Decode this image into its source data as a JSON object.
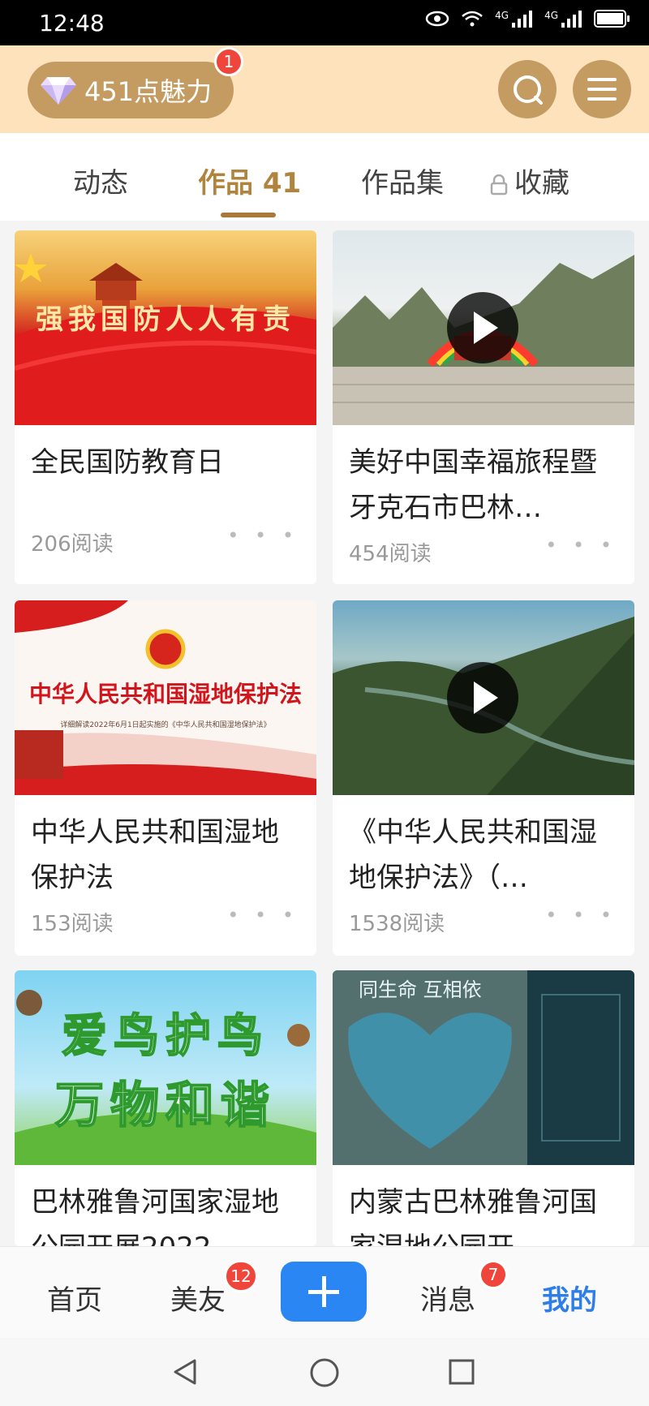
{
  "status": {
    "time": "12:48",
    "net1": "4G",
    "net2": "4G"
  },
  "header": {
    "points_label": "451点魅力",
    "points_badge": "1"
  },
  "tabs": [
    {
      "label": "动态"
    },
    {
      "label": "作品 41",
      "active": true
    },
    {
      "label": "作品集"
    },
    {
      "label": "收藏",
      "locked": true
    }
  ],
  "cards": [
    {
      "title": "全民国防教育日",
      "reads": "206阅读",
      "image_text": "强我国防人人有责",
      "video": false
    },
    {
      "title": "美好中国幸福旅程暨牙克石市巴林…",
      "reads": "454阅读",
      "video": true
    },
    {
      "title": "中华人民共和国湿地保护法",
      "reads": "153阅读",
      "image_text": "中华人民共和国湿地保护法",
      "image_subtext": "详细解读2022年6月1日起实施的《中华人民共和国湿地保护法》",
      "video": false
    },
    {
      "title": "《中华人民共和国湿地保护法》（…",
      "reads": "1538阅读",
      "video": true
    },
    {
      "title": "巴林雅鲁河国家湿地公园开展2022",
      "image_text_line1": "爱鸟护鸟",
      "image_text_line2": "万物和谐",
      "video": false
    },
    {
      "title": "内蒙古巴林雅鲁河国家湿地公园开",
      "image_text": "同生命 互相依",
      "video": false
    }
  ],
  "more_label": "• • •",
  "bottom_nav": {
    "home": "首页",
    "friends": "美友",
    "friends_badge": "12",
    "messages": "消息",
    "messages_badge": "7",
    "mine": "我的"
  },
  "colors": {
    "accent_gold": "#b0843d",
    "header_bg": "#fde2bc",
    "blue": "#2a86f2",
    "badge_red": "#f0453a"
  }
}
